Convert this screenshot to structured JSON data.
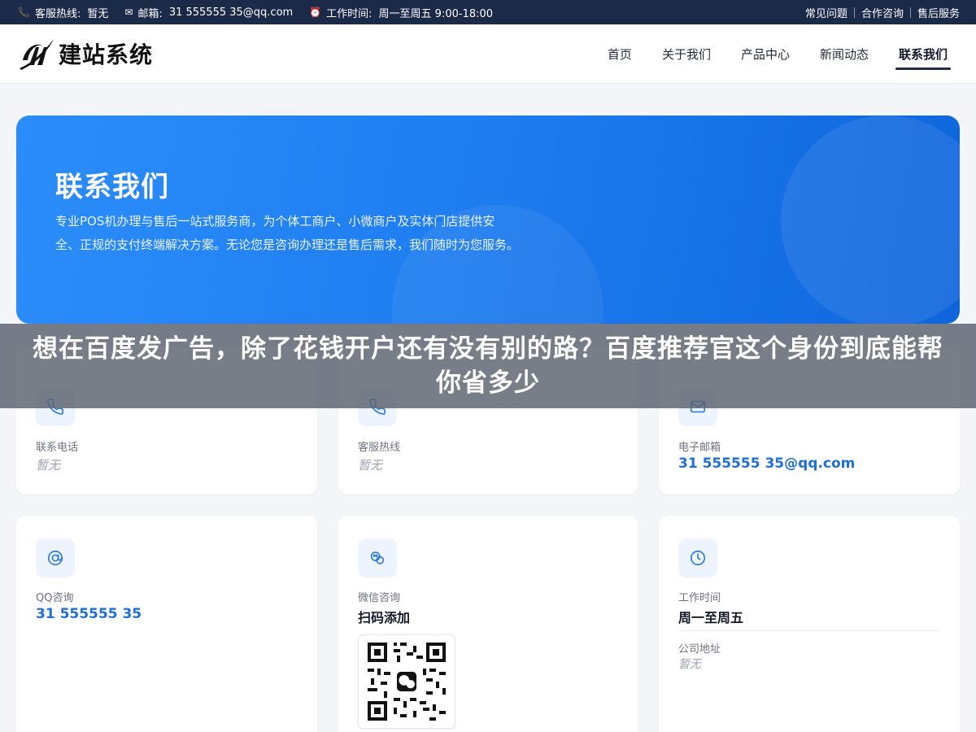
{
  "topbar": {
    "hotline_label": "客服热线:",
    "hotline_value": "暂无",
    "email_label": "邮箱:",
    "email_value": "31 555555 35@qq.com",
    "hours_label": "工作时间:",
    "hours_value": "周一至周五 9:00-18:00",
    "links": [
      "常见问题",
      "合作咨询",
      "售后服务"
    ]
  },
  "header": {
    "logo_text": "建站系统",
    "nav": [
      "首页",
      "关于我们",
      "产品中心",
      "新闻动态",
      "联系我们"
    ],
    "active_nav": "联系我们"
  },
  "hero": {
    "title": "联系我们",
    "description": "专业POS机办理与售后一站式服务商，为个体工商户、小微商户及实体门店提供安全、正规的支付终端解决方案。无论您是咨询办理还是售后需求，我们随时为您服务。"
  },
  "cards": {
    "phone": {
      "label": "联系电话",
      "value": "暂无",
      "icon": "phone-icon"
    },
    "hotline": {
      "label": "客服热线",
      "value": "暂无",
      "icon": "phone-icon"
    },
    "email": {
      "label": "电子邮箱",
      "value": "31 555555 35@qq.com",
      "icon": "mail-icon"
    },
    "qq": {
      "label": "QQ咨询",
      "value": "31 555555 35",
      "icon": "qq-icon"
    },
    "wechat": {
      "label": "微信咨询",
      "value": "扫码添加",
      "icon": "wechat-icon"
    },
    "hours": {
      "label": "工作时间",
      "value": "周一至周五",
      "address_label": "公司地址",
      "address_value": "暂无",
      "icon": "clock-icon"
    }
  },
  "overlay": {
    "headline": "想在百度发广告，除了花钱开户还有没有别的路？百度推荐官这个身份到底能帮你省多少"
  },
  "colors": {
    "topbar": "#1c2a4a",
    "hero_start": "#2b8dfa",
    "hero_end": "#0f66dc",
    "accent": "#1e6fd9"
  }
}
